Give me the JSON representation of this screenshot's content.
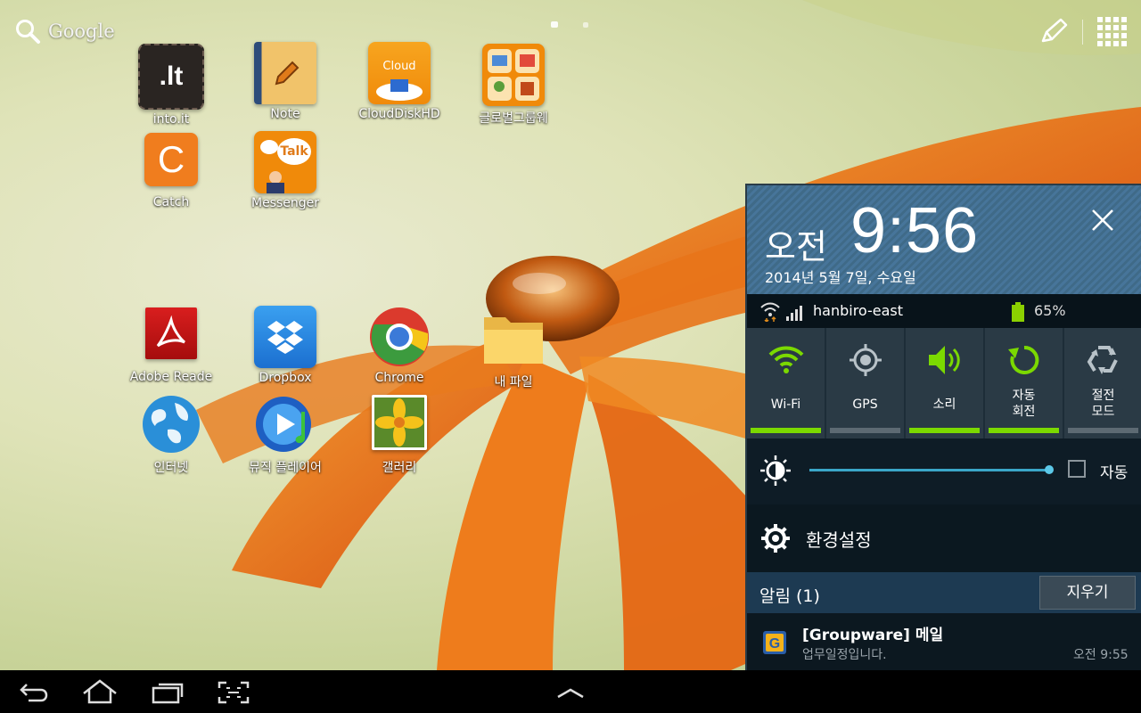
{
  "search": {
    "label": "Google"
  },
  "apps": [
    {
      "label": "into.it",
      "icon": "into-it-icon"
    },
    {
      "label": "Note",
      "icon": "note-icon"
    },
    {
      "label": "CloudDiskHD",
      "icon": "cloud-disk-icon",
      "badge": "Cloud"
    },
    {
      "label": "글로벌그룹웨",
      "icon": "groupware-icon"
    },
    {
      "label": "Catch",
      "icon": "catch-icon",
      "glyph": "C"
    },
    {
      "label": "Messenger",
      "icon": "messenger-icon",
      "badge": "Talk"
    },
    {
      "label": "Adobe Reade",
      "icon": "adobe-reader-icon"
    },
    {
      "label": "Dropbox",
      "icon": "dropbox-icon"
    },
    {
      "label": "Chrome",
      "icon": "chrome-icon"
    },
    {
      "label": "내 파일",
      "icon": "folder-icon"
    },
    {
      "label": "인터넷",
      "icon": "globe-icon"
    },
    {
      "label": "뮤직 플레이어",
      "icon": "music-player-icon"
    },
    {
      "label": "갤러리",
      "icon": "gallery-icon"
    }
  ],
  "panel": {
    "ampm": "오전",
    "time": "9:56",
    "date": "2014년 5월 7일, 수요일",
    "network": "hanbiro-east",
    "battery": "65%",
    "toggles": [
      {
        "label": "Wi-Fi",
        "icon": "wifi-icon",
        "on": true
      },
      {
        "label": "GPS",
        "icon": "gps-icon",
        "on": false
      },
      {
        "label": "소리",
        "icon": "sound-icon",
        "on": true
      },
      {
        "label": "자동\n회전",
        "line1": "자동",
        "line2": "회전",
        "icon": "rotate-icon",
        "on": true
      },
      {
        "label": "절전\n모드",
        "line1": "절전",
        "line2": "모드",
        "icon": "power-saving-icon",
        "on": false
      }
    ],
    "brightness_auto_label": "자동",
    "settings_label": "환경설정",
    "notifications_header": "알림 (1)",
    "clear_label": "지우기",
    "notification": {
      "title": "[Groupware] 메일",
      "text": "업무일정입니다.",
      "time": "오전 9:55"
    }
  },
  "colors": {
    "accent_on": "#7bd900",
    "panel_bg": "#0e1c26",
    "clock_bg": "#3f6a88"
  }
}
